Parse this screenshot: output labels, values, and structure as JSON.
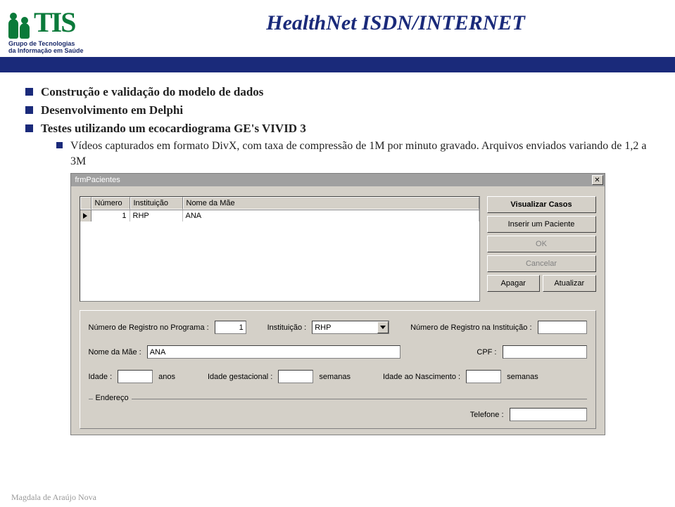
{
  "logo": {
    "letters": "TIS",
    "sub1": "Grupo de Tecnologias",
    "sub2": "da Informação em Saúde"
  },
  "title": "HealthNet ISDN/INTERNET",
  "bullets": {
    "b1": "Construção e validação do modelo de dados",
    "b2": "Desenvolvimento em Delphi",
    "b3": "Testes utilizando um ecocardiograma GE's VIVID 3",
    "b3a": "Vídeos capturados em formato DivX, com taxa de compressão de 1M por minuto gravado. Arquivos enviados variando de 1,2 a 3M"
  },
  "window": {
    "title": "frmPacientes",
    "grid": {
      "headers": {
        "num": "Número",
        "inst": "Instituição",
        "mae": "Nome da Mãe"
      },
      "row": {
        "num": "1",
        "inst": "RHP",
        "mae": "ANA"
      }
    },
    "buttons": {
      "visualizar": "Visualizar Casos",
      "inserir": "Inserir um Paciente",
      "ok": "OK",
      "cancelar": "Cancelar",
      "apagar": "Apagar",
      "atualizar": "Atualizar"
    },
    "form": {
      "regProg": {
        "label": "Número de Registro no Programa :",
        "value": "1"
      },
      "inst": {
        "label": "Instituição :",
        "value": "RHP"
      },
      "regInst": {
        "label": "Número de Registro na Instituição :",
        "value": ""
      },
      "mae": {
        "label": "Nome da Mãe :",
        "value": "ANA"
      },
      "cpf": {
        "label": "CPF :",
        "value": ""
      },
      "idade": {
        "label": "Idade :",
        "unit": "anos",
        "value": ""
      },
      "gest": {
        "label": "Idade gestacional :",
        "unit": "semanas",
        "value": ""
      },
      "nasc": {
        "label": "Idade ao Nascimento :",
        "unit": "semanas",
        "value": ""
      },
      "endereco": "Endereço",
      "telefone": {
        "label": "Telefone :",
        "value": ""
      }
    }
  },
  "footer": "Magdala de Araújo Nova"
}
